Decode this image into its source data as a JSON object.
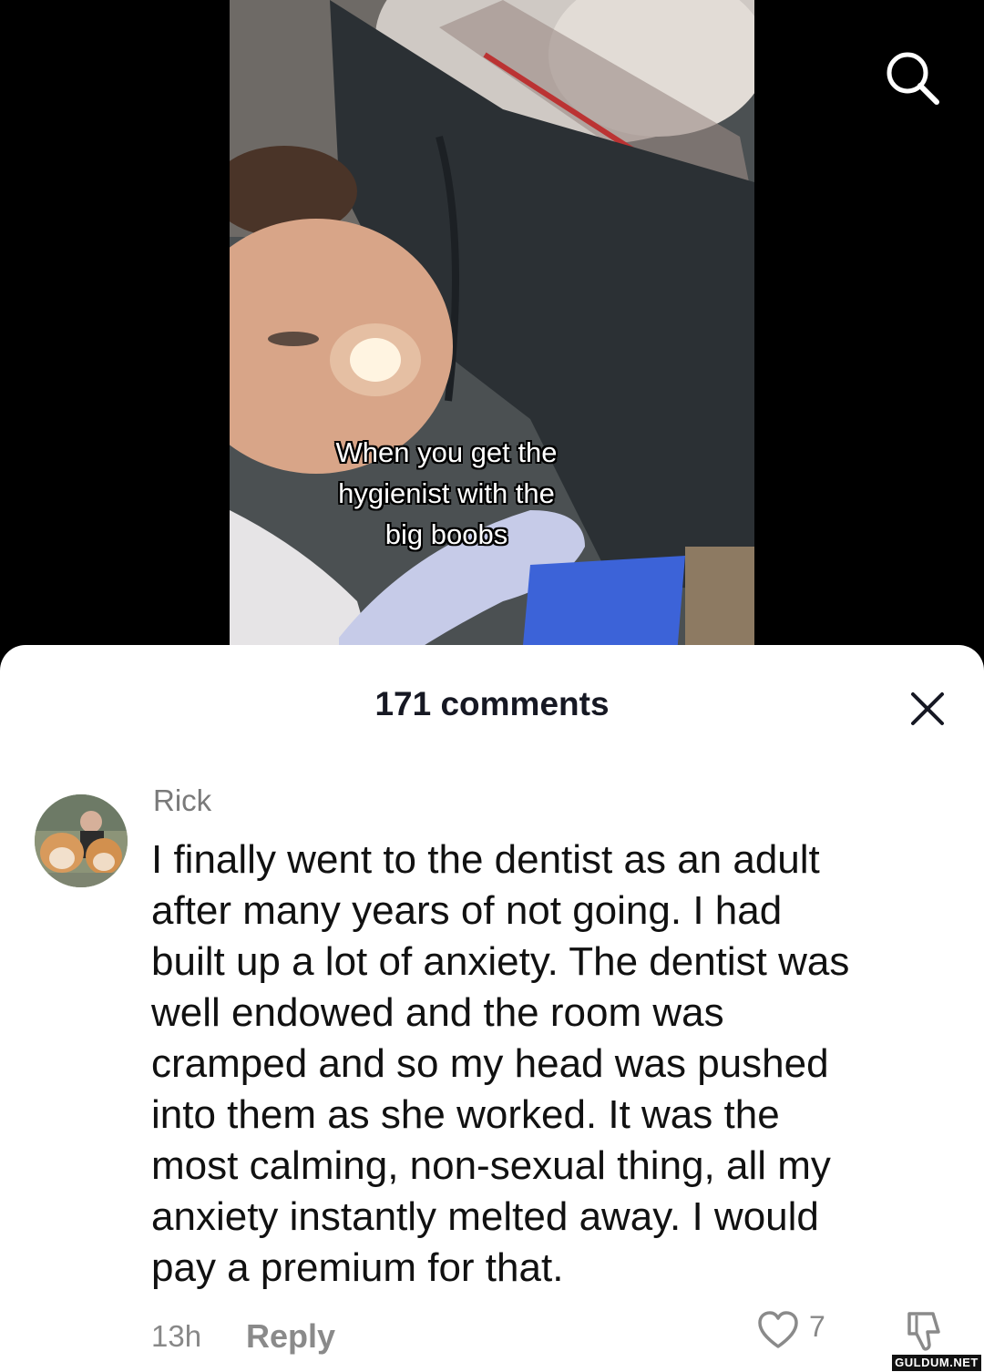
{
  "video": {
    "caption_lines": [
      "When you get the",
      "hygienist with the",
      "big boobs"
    ],
    "search_icon": "search-icon"
  },
  "comments_sheet": {
    "title": "171 comments",
    "close_icon": "close-icon",
    "comment": {
      "author": "Rick",
      "text_lines": [
        "I finally went to the dentist as an adult",
        "after many years of not going. I had",
        "built up a lot of anxiety. The dentist was",
        "well endowed and the room was",
        "cramped and so my head was pushed",
        "into them as she worked. It was the",
        "most calming, non-sexual thing, all my",
        "anxiety instantly melted away. I would",
        "pay a premium for that."
      ],
      "time": "13h",
      "reply_label": "Reply",
      "like_count": "7",
      "like_icon": "heart-icon",
      "dislike_icon": "thumbs-down-icon"
    }
  },
  "watermark": "GULDUM.NET"
}
